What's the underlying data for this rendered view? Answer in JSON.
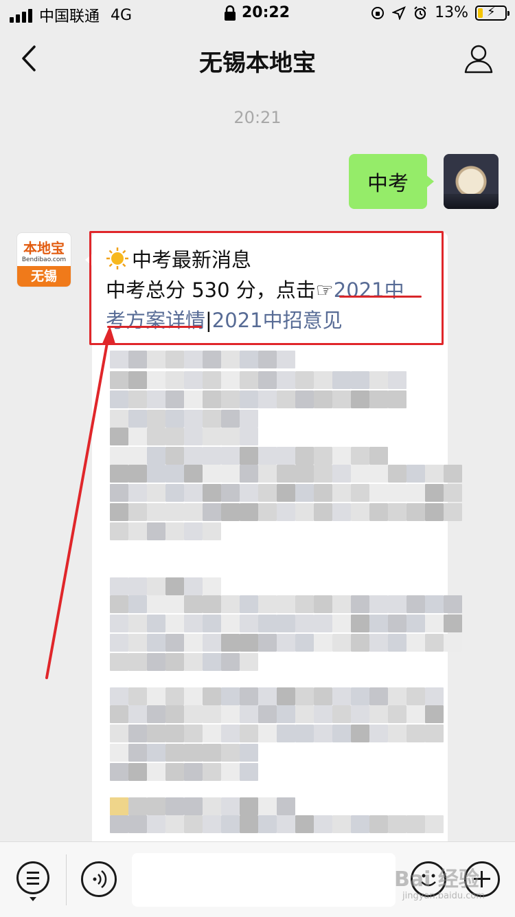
{
  "status_bar": {
    "carrier": "中国联通",
    "network": "4G",
    "time": "20:22",
    "battery_percent": "13%",
    "icons": [
      "signal-icon",
      "lock-icon",
      "orientation-lock-icon",
      "location-icon",
      "alarm-icon",
      "battery-icon"
    ]
  },
  "header": {
    "title": "无锡本地宝",
    "back_icon": "chevron-left-icon",
    "profile_icon": "person-icon"
  },
  "chat": {
    "timestamp": "20:21",
    "messages": [
      {
        "from": "self",
        "text": "中考"
      },
      {
        "from": "bot",
        "sender_avatar": {
          "brand": "本地宝",
          "domain": "Bendibao.com",
          "city": "无锡"
        },
        "line1": "中考最新消息",
        "line2_prefix": "中考总分 530 分，点击☞",
        "link1_a": "2021中",
        "link1_b": "考方案详情",
        "separator": "|",
        "link2": "2021中招意见"
      }
    ]
  },
  "bottom_bar": {
    "input_placeholder": "",
    "icons": [
      "menu-icon",
      "voice-icon",
      "emoji-icon",
      "plus-icon"
    ]
  },
  "watermark": {
    "text": "Bai 经验",
    "sub": "jingyan.baidu.com"
  },
  "colors": {
    "background": "#ededed",
    "self_bubble": "#95ec69",
    "link": "#576b95",
    "annotation_red": "#e0262a"
  }
}
